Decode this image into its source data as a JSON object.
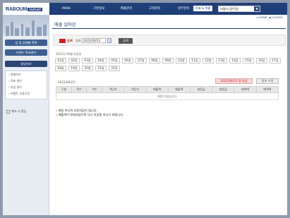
{
  "header": {
    "logo_main": "RABOUM",
    "logo_sub": "OUTLET",
    "nav": [
      "MAIN",
      "기본정보",
      "매출관리",
      "고객관리",
      "업무관리"
    ],
    "top_button": "목표 & 현황",
    "store_select": "씨월드(광주점)",
    "home_link": "HOME",
    "logout_link": "LOGOUT"
  },
  "sidebar": {
    "btn1": "업 및 업체별 목록",
    "btn2": "브랜드 목표관리",
    "btn3": "영업속보",
    "submenu": [
      "일별속보",
      "목표 관리",
      "마감 관리",
      "이벤트 사용규정"
    ],
    "checkbox_label": "체크 시 합입"
  },
  "main": {
    "title": "매출 일마감",
    "search_tag": "검색",
    "date_label": "일자",
    "date_value": "2022/06/23",
    "search_button": "검색",
    "month_label": "2022년 06월 마감일",
    "days": [
      "01일",
      "02일",
      "03일",
      "04일",
      "05일",
      "06일",
      "07일",
      "08일",
      "09일",
      "10일",
      "11일",
      "12일",
      "13일",
      "14일",
      "15일",
      "16일",
      "17일",
      "18일",
      "19일",
      "20일",
      "21일",
      "22일"
    ],
    "period": "- 2022/06/23 -",
    "close_button": "2022/06/23 일 마감",
    "info_button": "정보 수정",
    "columns": [
      "구분",
      "객수",
      "객수",
      "객단가",
      "객단가",
      "매출액",
      "매출액",
      "대전금",
      "대전금",
      "매액액",
      "매액액"
    ],
    "empty_message": "내용이 없습니다.",
    "notes": [
      "매일 하나씩 자동마감이 됩니다.",
      "매출액이 변경되었으면 다시 마감을 하시기 바랍니다."
    ]
  }
}
